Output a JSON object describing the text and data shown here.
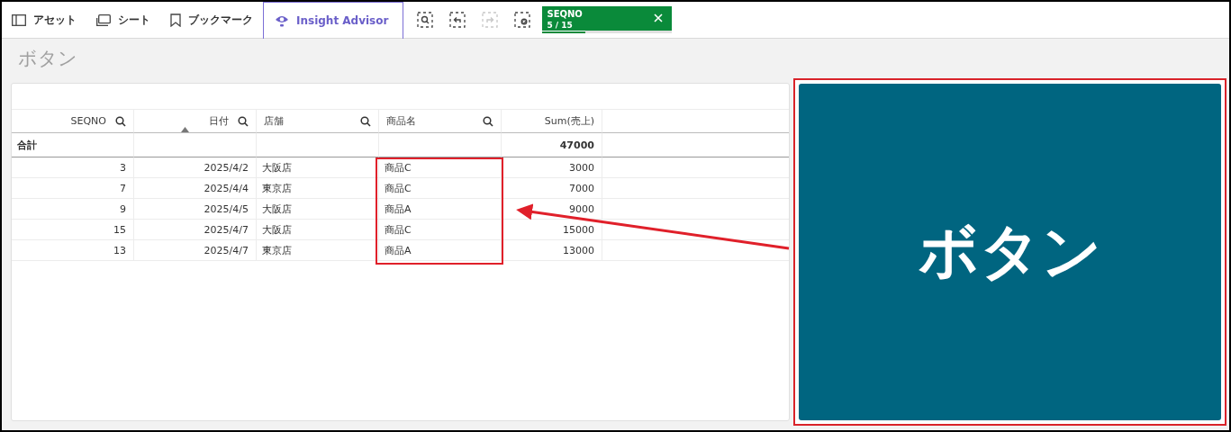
{
  "toolbar": {
    "items": [
      {
        "label": "アセット",
        "kind": "assets"
      },
      {
        "label": "シート",
        "kind": "sheet"
      },
      {
        "label": "ブックマーク",
        "kind": "bookmark"
      }
    ],
    "insight_advisor": {
      "label": "Insight Advisor",
      "selected": true
    },
    "tools": [
      {
        "kind": "search",
        "disabled": false
      },
      {
        "kind": "back",
        "disabled": false
      },
      {
        "kind": "forward",
        "disabled": true
      },
      {
        "kind": "clear",
        "disabled": false
      }
    ],
    "selection": {
      "field": "SEQNO",
      "count": "5 / 15",
      "level": 0.333
    }
  },
  "page_title": "ボタン",
  "table": {
    "columns": [
      {
        "label": "SEQNO",
        "searchable": true,
        "sorted": false
      },
      {
        "label": "日付",
        "searchable": true,
        "sorted": true
      },
      {
        "label": "店舗",
        "searchable": true,
        "sorted": false
      },
      {
        "label": "商品名",
        "searchable": true,
        "sorted": false
      },
      {
        "label": "Sum(売上)",
        "searchable": false,
        "sorted": false
      }
    ],
    "totals": {
      "label": "合計",
      "value": "47000"
    },
    "rows": [
      [
        "3",
        "2025/4/2",
        "大阪店",
        "商品C",
        "3000"
      ],
      [
        "7",
        "2025/4/4",
        "東京店",
        "商品C",
        "7000"
      ],
      [
        "9",
        "2025/4/5",
        "大阪店",
        "商品A",
        "9000"
      ],
      [
        "15",
        "2025/4/7",
        "大阪店",
        "商品C",
        "15000"
      ],
      [
        "13",
        "2025/4/7",
        "東京店",
        "商品A",
        "13000"
      ]
    ]
  },
  "button": {
    "label": "ボタン"
  }
}
